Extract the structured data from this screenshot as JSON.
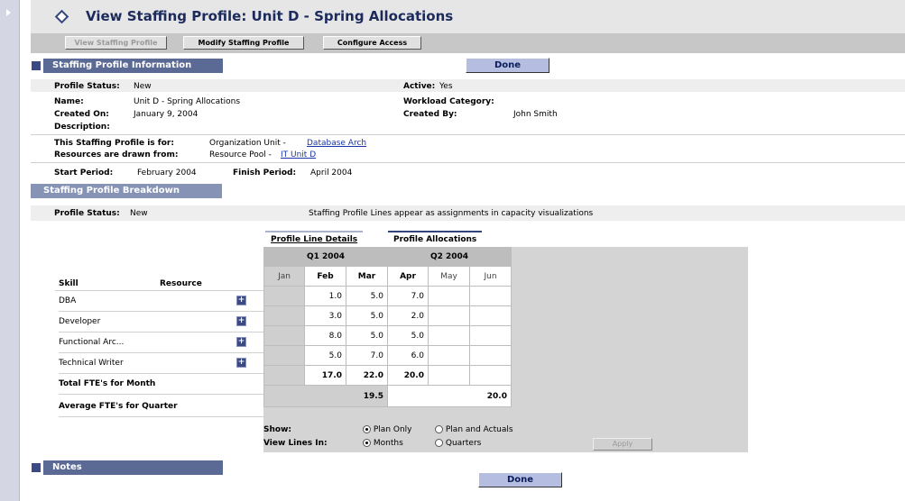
{
  "page": {
    "title": "View Staffing Profile: Unit D - Spring Allocations"
  },
  "toolbar": {
    "view_label": "View Staffing Profile",
    "modify_label": "Modify Staffing Profile",
    "configure_label": "Configure Access"
  },
  "info": {
    "section_title": "Staffing Profile Information",
    "done_label": "Done",
    "profile_status_label": "Profile Status:",
    "profile_status_value": "New",
    "active_label": "Active:",
    "active_value": "Yes",
    "name_label": "Name:",
    "name_value": "Unit D - Spring Allocations",
    "workload_label": "Workload Category:",
    "created_on_label": "Created On:",
    "created_on_value": "January 9, 2004",
    "created_by_label": "Created By:",
    "created_by_value": "John Smith",
    "description_label": "Description:",
    "for_label": "This Staffing Profile is for:",
    "for_prefix": "Organization Unit -",
    "for_link": "Database Arch",
    "drawn_label": "Resources are drawn from:",
    "drawn_prefix": "Resource Pool -",
    "drawn_link": "IT Unit D",
    "start_label": "Start Period:",
    "start_value": "February 2004",
    "finish_label": "Finish Period:",
    "finish_value": "April 2004"
  },
  "breakdown": {
    "section_title": "Staffing Profile Breakdown",
    "status_label": "Profile Status:",
    "status_value": "New",
    "note": "Staffing Profile Lines appear as assignments in capacity visualizations",
    "tab_details": "Profile Line Details",
    "tab_allocations": "Profile Allocations",
    "col_skill": "Skill",
    "col_resource": "Resource",
    "quarters": [
      "Q1 2004",
      "Q2 2004"
    ],
    "months": [
      "Jan",
      "Feb",
      "Mar",
      "Apr",
      "May",
      "Jun"
    ],
    "rows": [
      {
        "skill": "DBA",
        "values": [
          "",
          "1.0",
          "5.0",
          "7.0",
          "",
          ""
        ]
      },
      {
        "skill": "Developer",
        "values": [
          "",
          "3.0",
          "5.0",
          "2.0",
          "",
          ""
        ]
      },
      {
        "skill": "Functional Arc...",
        "values": [
          "",
          "8.0",
          "5.0",
          "5.0",
          "",
          ""
        ]
      },
      {
        "skill": "Technical Writer",
        "values": [
          "",
          "5.0",
          "7.0",
          "6.0",
          "",
          ""
        ]
      }
    ],
    "total_label": "Total FTE's for Month",
    "total_values": [
      "",
      "17.0",
      "22.0",
      "20.0",
      "",
      ""
    ],
    "avg_label": "Average FTE's for Quarter",
    "avg_values": [
      "19.5",
      "20.0"
    ],
    "show_label": "Show:",
    "plan_only": "Plan Only",
    "plan_actuals": "Plan and Actuals",
    "view_in_label": "View Lines In:",
    "months_opt": "Months",
    "quarters_opt": "Quarters",
    "apply_label": "Apply"
  },
  "notes": {
    "section_title": "Notes",
    "done_label": "Done"
  }
}
